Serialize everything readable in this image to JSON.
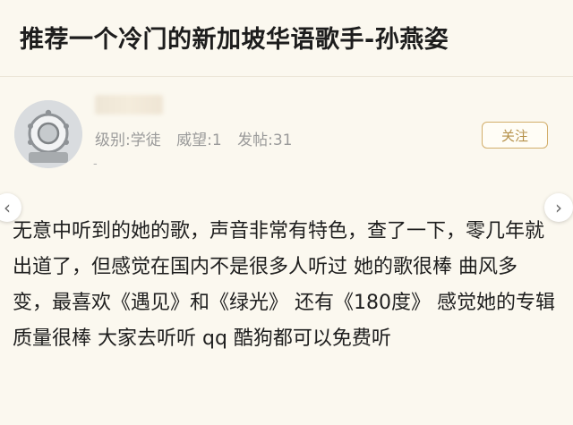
{
  "post": {
    "title": "推荐一个冷门的新加坡华语歌手-孙燕姿",
    "author": {
      "level": "级别:学徒",
      "prestige": "威望:1",
      "posts": "发帖:31",
      "signature": "-"
    },
    "follow_label": "关注",
    "content": "无意中听到的她的歌，声音非常有特色，查了一下，零几年就出道了，但感觉在国内不是很多人听过 她的歌很棒 曲风多变，最喜欢《遇见》和《绿光》 还有《180度》 感觉她的专辑质量很棒 大家去听听 qq 酷狗都可以免费听"
  },
  "nav": {
    "prev_icon": "‹",
    "next_icon": "›"
  },
  "colors": {
    "background": "#fbf8ef",
    "accent": "#d2ae6a"
  }
}
